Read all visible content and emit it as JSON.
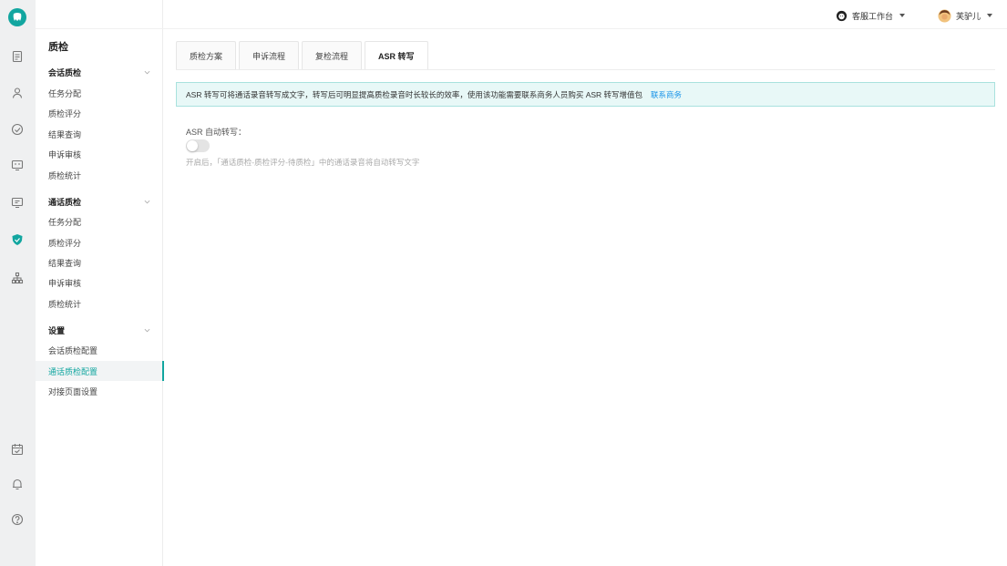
{
  "header": {
    "workspace_label": "客服工作台",
    "user_name": "芙驴儿"
  },
  "rail": {
    "icons": [
      "list-icon",
      "users-icon",
      "gauge-icon",
      "chat-icon",
      "monitor-icon",
      "shield-icon",
      "org-icon",
      "calendar-icon",
      "bell-icon",
      "help-icon"
    ],
    "active_icon": "shield-icon",
    "accent_color": "#12a6a0"
  },
  "sidebar": {
    "title": "质检",
    "groups": [
      {
        "label": "会话质检",
        "items": [
          "任务分配",
          "质检评分",
          "结果查询",
          "申诉审核",
          "质检统计"
        ]
      },
      {
        "label": "通话质检",
        "items": [
          "任务分配",
          "质检评分",
          "结果查询",
          "申诉审核",
          "质检统计"
        ]
      },
      {
        "label": "设置",
        "items": [
          "会话质检配置",
          "通话质检配置",
          "对接页面设置"
        ]
      }
    ],
    "active_item": "通话质检配置"
  },
  "tabs": [
    "质检方案",
    "申诉流程",
    "复检流程",
    "ASR 转写"
  ],
  "active_tab": "ASR 转写",
  "alert": {
    "text": "ASR 转写可将通话录音转写成文字，转写后可明显提高质检录音时长较长的效率，使用该功能需要联系商务人员购买 ASR 转写增值包",
    "link": "联系商务",
    "link_color": "#1893e8"
  },
  "form": {
    "label": "ASR 自动转写：",
    "switch_on": false,
    "hint": "开启后，「通话质检-质检评分-待质检」中的通话录音将自动转写文字"
  }
}
